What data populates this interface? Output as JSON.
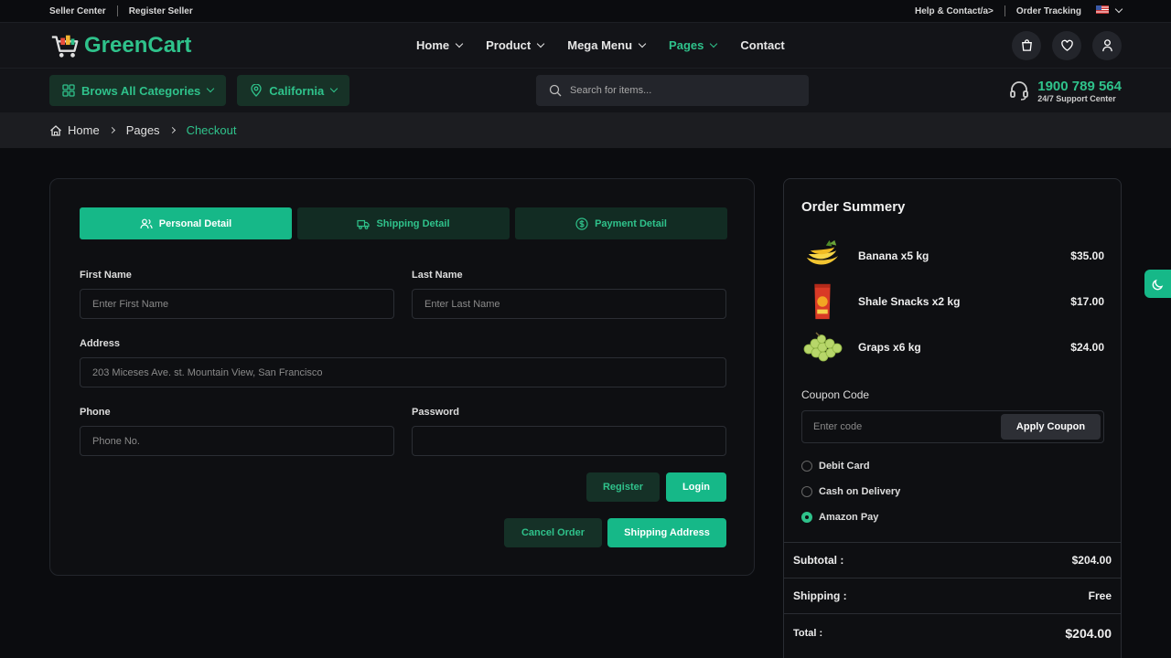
{
  "topbar": {
    "seller_center": "Seller Center",
    "register_seller": "Register Seller",
    "help": "Help & Contact/a>",
    "order_tracking": "Order Tracking"
  },
  "brand": {
    "name": "GreenCart",
    "accent": "#2fc28b"
  },
  "nav": {
    "items": [
      {
        "label": "Home"
      },
      {
        "label": "Product"
      },
      {
        "label": "Mega Menu"
      },
      {
        "label": "Pages"
      },
      {
        "label": "Contact"
      }
    ],
    "icons": [
      "bag-icon",
      "heart-icon",
      "user-icon"
    ]
  },
  "subbar": {
    "categories": "Brows All Categories",
    "location": "California",
    "search_placeholder": "Search for items...",
    "support_number": "1900 789 564",
    "support_text": "24/7 Support Center"
  },
  "breadcrumb": {
    "home": "Home",
    "pages": "Pages",
    "current": "Checkout"
  },
  "checkout": {
    "tabs": [
      "Personal Detail",
      "Shipping Detail",
      "Payment Detail"
    ],
    "first_name_label": "First Name",
    "first_name_placeholder": "Enter First Name",
    "last_name_label": "Last Name",
    "last_name_placeholder": "Enter Last Name",
    "address_label": "Address",
    "address_placeholder": "203 Miceses Ave. st. Mountain View, San Francisco",
    "phone_label": "Phone",
    "phone_placeholder": "Phone No.",
    "password_label": "Password",
    "password_placeholder": "",
    "register": "Register",
    "login": "Login",
    "cancel_order": "Cancel Order",
    "shipping_address": "Shipping Address"
  },
  "summary": {
    "title": "Order Summery",
    "items": [
      {
        "name": "Banana x5 kg",
        "price": "$35.00"
      },
      {
        "name": "Shale Snacks x2 kg",
        "price": "$17.00"
      },
      {
        "name": "Graps x6 kg",
        "price": "$24.00"
      }
    ],
    "coupon_label": "Coupon Code",
    "coupon_placeholder": "Enter code",
    "apply_coupon": "Apply Coupon",
    "payment_options": [
      "Debit Card",
      "Cash on Delivery",
      "Amazon Pay"
    ],
    "selected_payment": "Amazon Pay",
    "subtotal_label": "Subtotal :",
    "subtotal": "$204.00",
    "shipping_label": "Shipping :",
    "shipping": "Free",
    "total_label": "Total :",
    "total": "$204.00"
  }
}
